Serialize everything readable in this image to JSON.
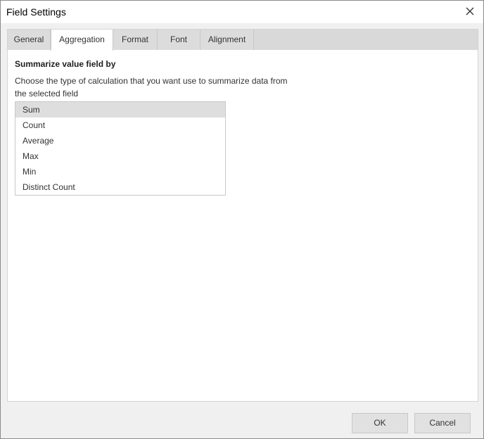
{
  "window": {
    "title": "Field Settings",
    "close_icon": "close-icon"
  },
  "tabs": [
    {
      "label": "General",
      "active": false
    },
    {
      "label": "Aggregation",
      "active": true
    },
    {
      "label": "Format",
      "active": false
    },
    {
      "label": "Font",
      "active": false
    },
    {
      "label": "Alignment",
      "active": false
    }
  ],
  "aggregation": {
    "heading": "Summarize value field by",
    "description": "Choose the type of calculation that you want use to summarize data from the selected field",
    "options": [
      "Sum",
      "Count",
      "Average",
      "Max",
      "Min",
      "Distinct Count"
    ],
    "selected": "Sum"
  },
  "buttons": {
    "ok": "OK",
    "cancel": "Cancel"
  }
}
